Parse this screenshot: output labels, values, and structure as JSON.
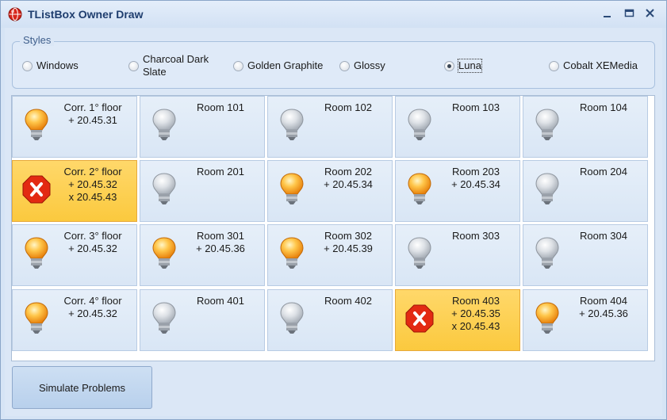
{
  "window": {
    "title": "TListBox Owner Draw",
    "icon": "red-sphere-app-icon",
    "controls": [
      "minimize-icon",
      "maximize-icon",
      "close-icon"
    ]
  },
  "styles": {
    "group_title": "Styles",
    "options": [
      {
        "label": "Windows",
        "checked": false
      },
      {
        "label": "Charcoal Dark\nSlate",
        "checked": false
      },
      {
        "label": "Golden Graphite",
        "checked": false
      },
      {
        "label": "Glossy",
        "checked": false
      },
      {
        "label": "Luna",
        "checked": true
      },
      {
        "label": "Cobalt XEMedia",
        "checked": false
      }
    ]
  },
  "colors": {
    "alarm_background": "#fbc93e",
    "cell_background": "#dde8f6",
    "bulb_on": "#f59d1a",
    "bulb_off": "#c8cdd3",
    "error_badge": "#e32a12"
  },
  "rooms": [
    [
      {
        "text": "Corr. 1° floor\n+ 20.45.31",
        "state": "on"
      },
      {
        "text": "Room 101",
        "state": "off"
      },
      {
        "text": "Room 102",
        "state": "off"
      },
      {
        "text": "Room 103",
        "state": "off"
      },
      {
        "text": "Room 104",
        "state": "off"
      }
    ],
    [
      {
        "text": "Corr. 2° floor\n+ 20.45.32\nx 20.45.43",
        "state": "alarm"
      },
      {
        "text": "Room 201",
        "state": "off"
      },
      {
        "text": "Room 202\n+ 20.45.34",
        "state": "on"
      },
      {
        "text": "Room 203\n+ 20.45.34",
        "state": "on"
      },
      {
        "text": "Room 204",
        "state": "off"
      }
    ],
    [
      {
        "text": "Corr. 3° floor\n+ 20.45.32",
        "state": "on"
      },
      {
        "text": "Room 301\n+ 20.45.36",
        "state": "on"
      },
      {
        "text": "Room 302\n+ 20.45.39",
        "state": "on"
      },
      {
        "text": "Room 303",
        "state": "off"
      },
      {
        "text": "Room 304",
        "state": "off"
      }
    ],
    [
      {
        "text": "Corr. 4° floor\n+ 20.45.32",
        "state": "on"
      },
      {
        "text": "Room 401",
        "state": "off"
      },
      {
        "text": "Room 402",
        "state": "off"
      },
      {
        "text": "Room 403\n+ 20.45.35\nx 20.45.43",
        "state": "alarm"
      },
      {
        "text": "Room 404\n+ 20.45.36",
        "state": "on"
      }
    ]
  ],
  "actions": {
    "simulate_label": "Simulate Problems"
  }
}
